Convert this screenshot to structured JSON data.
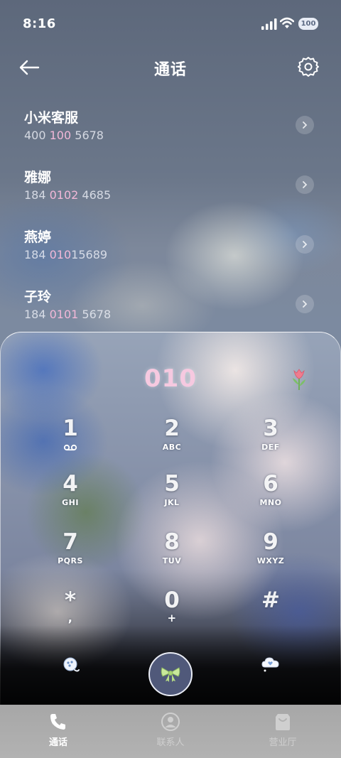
{
  "status_bar": {
    "time": "8:16",
    "battery": "100"
  },
  "header": {
    "title": "通话"
  },
  "calls": [
    {
      "name": "小米客服",
      "num_pre": "400 ",
      "num_hl": "100",
      "num_post": " 5678"
    },
    {
      "name": "雅娜",
      "num_pre": "184 ",
      "num_hl": "0102",
      "num_post": " 4685"
    },
    {
      "name": "燕婷",
      "num_pre": "184 ",
      "num_hl": "010",
      "num_post": "15689"
    },
    {
      "name": "子玲",
      "num_pre": "184 ",
      "num_hl": "0101",
      "num_post": " 5678"
    }
  ],
  "dialer": {
    "input": "010",
    "keys": [
      {
        "digit": "1",
        "letters": ""
      },
      {
        "digit": "2",
        "letters": "ABC"
      },
      {
        "digit": "3",
        "letters": "DEF"
      },
      {
        "digit": "4",
        "letters": "GHI"
      },
      {
        "digit": "5",
        "letters": "JKL"
      },
      {
        "digit": "6",
        "letters": "MNO"
      },
      {
        "digit": "7",
        "letters": "PQRS"
      },
      {
        "digit": "8",
        "letters": "TUV"
      },
      {
        "digit": "9",
        "letters": "WXYZ"
      },
      {
        "digit": "*",
        "letters": ","
      },
      {
        "digit": "0",
        "letters": "+"
      },
      {
        "digit": "#",
        "letters": ""
      }
    ]
  },
  "tabs": [
    {
      "label": "通话",
      "icon": "phone-icon"
    },
    {
      "label": "联系人",
      "icon": "contact-icon"
    },
    {
      "label": "营业厅",
      "icon": "store-icon"
    }
  ],
  "colors": {
    "highlight": "#f2b8d8",
    "input": "#f6c9e0",
    "call_button": "#50597a"
  }
}
